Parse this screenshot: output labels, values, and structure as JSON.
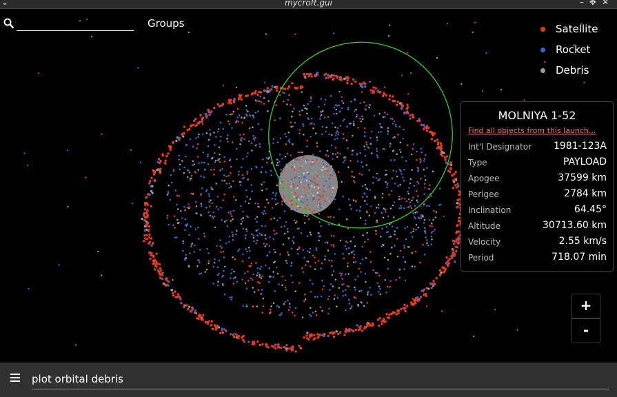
{
  "window": {
    "title": "mycroft.gui"
  },
  "search": {
    "value": "",
    "groups_label": "Groups"
  },
  "legend": [
    {
      "label": "Satellite",
      "color": "#e8391e"
    },
    {
      "label": "Rocket",
      "color": "#3b63c9"
    },
    {
      "label": "Debris",
      "color": "#9a9a9a"
    }
  ],
  "info": {
    "title": "MOLNIYA 1-52",
    "link": "Find all objects from this launch...",
    "rows": [
      {
        "key": "Int'l Designator",
        "value": "1981-123A"
      },
      {
        "key": "Type",
        "value": "PAYLOAD"
      },
      {
        "key": "Apogee",
        "value": "37599 km"
      },
      {
        "key": "Perigee",
        "value": "2784 km"
      },
      {
        "key": "Inclination",
        "value": "64.45°"
      },
      {
        "key": "Altitude",
        "value": "30713.60 km"
      },
      {
        "key": "Velocity",
        "value": "2.55 km/s"
      },
      {
        "key": "Period",
        "value": "718.07 min"
      }
    ]
  },
  "zoom": {
    "in_label": "+",
    "out_label": "-"
  },
  "command": {
    "value": "plot orbital debris"
  },
  "colors": {
    "orbit": "#2bd12b",
    "earth": "#9f9f9f",
    "satellite": "#e8391e",
    "rocket": "#3b63c9",
    "debris": "#9a9a9a"
  }
}
